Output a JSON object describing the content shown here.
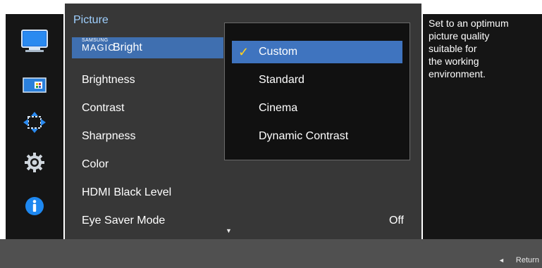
{
  "menu": {
    "title": "Picture",
    "items": [
      {
        "label": "Bright",
        "brand_small": "SAMSUNG",
        "brand_main": "MAGIC"
      },
      {
        "label": "Brightness"
      },
      {
        "label": "Contrast"
      },
      {
        "label": "Sharpness"
      },
      {
        "label": "Color"
      },
      {
        "label": "HDMI Black Level"
      },
      {
        "label": "Eye Saver Mode",
        "value": "Off"
      }
    ],
    "scroll_indicator": "▼"
  },
  "dropdown": {
    "options": [
      "Custom",
      "Standard",
      "Cinema",
      "Dynamic Contrast"
    ],
    "selected": "Custom",
    "check_glyph": "✓"
  },
  "help": {
    "text": "Set to an optimum\npicture quality\nsuitable for\nthe working\nenvironment."
  },
  "footer": {
    "return_label": "Return",
    "return_glyph": "◄"
  },
  "sidebar": {
    "icons": [
      "monitor-icon",
      "picture-size-icon",
      "position-arrows-icon",
      "settings-gear-icon",
      "information-icon"
    ]
  },
  "colors": {
    "highlight": "#3f6fb0",
    "check": "#ffd21f",
    "title": "#9fd0ff"
  }
}
